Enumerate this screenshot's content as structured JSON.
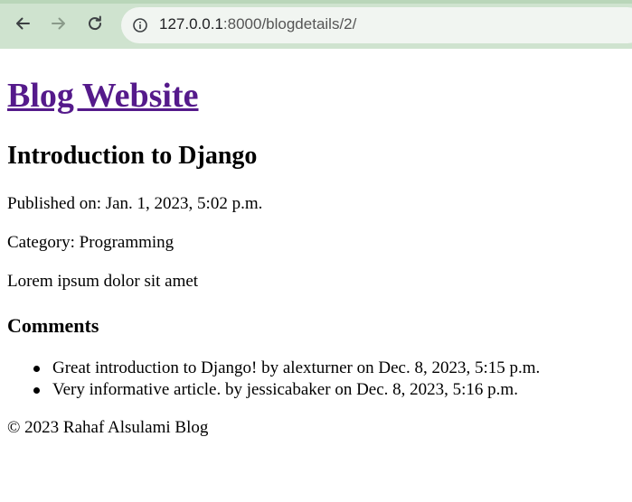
{
  "browser": {
    "url_host": "127.0.0.1",
    "url_path": ":8000/blogdetails/2/"
  },
  "site": {
    "title": "Blog Website"
  },
  "post": {
    "title": "Introduction to Django",
    "published": "Published on: Jan. 1, 2023, 5:02 p.m.",
    "category": "Category: Programming",
    "body": "Lorem ipsum dolor sit amet"
  },
  "comments": {
    "heading": "Comments",
    "items": [
      "Great introduction to Django! by alexturner on Dec. 8, 2023, 5:15 p.m.",
      "Very informative article. by jessicabaker on Dec. 8, 2023, 5:16 p.m."
    ]
  },
  "footer": {
    "text": "© 2023 Rahaf Alsulami Blog"
  },
  "icons": {
    "back": "arrow-left-icon",
    "forward": "arrow-right-icon",
    "reload": "reload-icon",
    "site_info": "info-icon"
  },
  "colors": {
    "toolbar": "#cfe3cf",
    "address_bar": "#f1f5f1",
    "visited_link": "#551a8b"
  }
}
